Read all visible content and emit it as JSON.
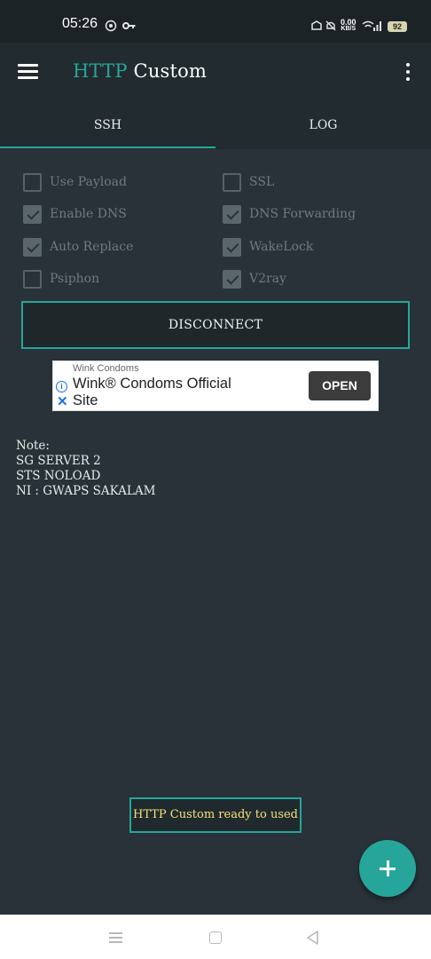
{
  "status_bar": {
    "time": "05:26",
    "icons": [
      "whatsapp-icon",
      "key-icon",
      "vpn-icon",
      "mute-icon",
      "wifi-icon",
      "signal-icon"
    ],
    "net_speed": "0.00",
    "net_unit": "KB/S",
    "battery": "92"
  },
  "app_bar": {
    "title_part1": "HTTP",
    "title_part2": "Custom",
    "accent_color": "#26a69a"
  },
  "tabs": [
    {
      "label": "SSH",
      "selected": true
    },
    {
      "label": "LOG",
      "selected": false
    }
  ],
  "options": [
    {
      "label": "Use Payload",
      "checked": false
    },
    {
      "label": "SSL",
      "checked": false
    },
    {
      "label": "Enable DNS",
      "checked": true
    },
    {
      "label": "DNS Forwarding",
      "checked": true
    },
    {
      "label": "Auto Replace",
      "checked": true
    },
    {
      "label": "WakeLock",
      "checked": true
    },
    {
      "label": "Psiphon",
      "checked": false
    },
    {
      "label": "V2ray",
      "checked": true
    }
  ],
  "disconnect_label": "DISCONNECT",
  "ad": {
    "brand": "Wink Condoms",
    "title": "Wink® Condoms Official Site",
    "button": "OPEN"
  },
  "note": {
    "heading": "Note:",
    "lines": [
      "SG SERVER 2",
      "STS NOLOAD",
      "NI : GWAPS SAKALAM"
    ]
  },
  "toast": "HTTP Custom ready to used"
}
